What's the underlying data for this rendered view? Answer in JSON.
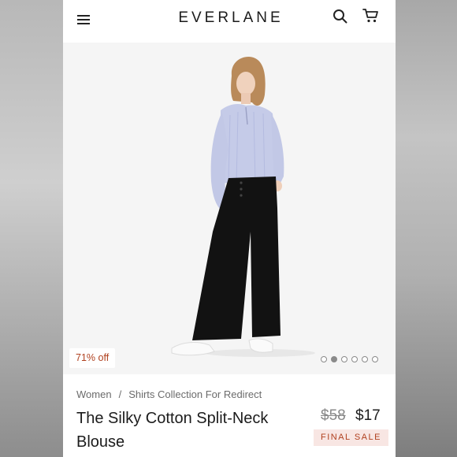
{
  "header": {
    "brand": "EVERLANE",
    "icons": [
      "menu-icon",
      "search-icon",
      "cart-icon"
    ]
  },
  "hero": {
    "badge": "71% off",
    "carousel": {
      "total": 6,
      "active": 1
    }
  },
  "product": {
    "breadcrumb": [
      "Women",
      "Shirts Collection For Redirect"
    ],
    "breadcrumb_sep": "/",
    "title": "The Silky Cotton Split-Neck Blouse",
    "price_original": "$58",
    "price_sale": "$17",
    "sale_tag": "FINAL SALE"
  },
  "colors": {
    "accent": "#b0411f",
    "sale_tag_bg": "#f8e6e3",
    "text": "#1c1c1c"
  }
}
